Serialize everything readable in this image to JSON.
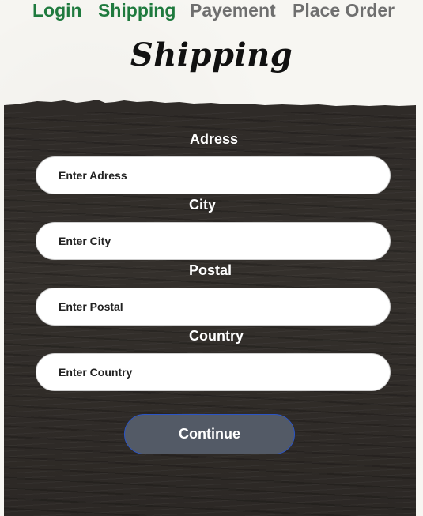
{
  "steps": [
    {
      "label": "Login",
      "status": "done"
    },
    {
      "label": "Shipping",
      "status": "done"
    },
    {
      "label": "Payement",
      "status": "pending"
    },
    {
      "label": "Place Order",
      "status": "pending"
    }
  ],
  "page": {
    "title": "Shipping"
  },
  "form": {
    "address": {
      "label": "Adress",
      "placeholder": "Enter Adress",
      "value": ""
    },
    "city": {
      "label": "City",
      "placeholder": "Enter City",
      "value": ""
    },
    "postal": {
      "label": "Postal",
      "placeholder": "Enter Postal",
      "value": ""
    },
    "country": {
      "label": "Country",
      "placeholder": "Enter Country",
      "value": ""
    },
    "submit_label": "Continue"
  },
  "colors": {
    "step_done": "#1f7a3e",
    "step_pending": "#6f6f6f",
    "panel_background": "#2f2b28",
    "button_background": "#535a66",
    "button_border": "#2b55c7"
  }
}
